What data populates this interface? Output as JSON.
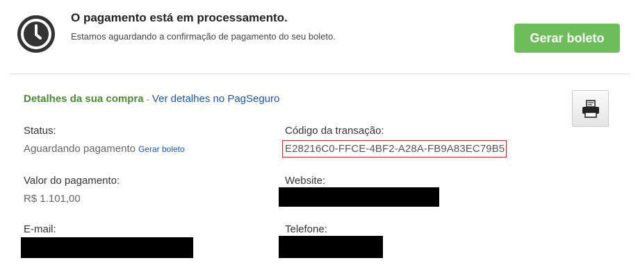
{
  "banner": {
    "title": "O pagamento está em processamento.",
    "description": "Estamos aguardando a confirmação de pagamento do seu boleto.",
    "button_label": "Gerar boleto",
    "icon": "clock-icon",
    "button_color": "#6dbd5b"
  },
  "details": {
    "heading": "Detalhes da sua compra",
    "separator": "-",
    "link": "Ver detalhes no PagSeguro",
    "print_icon": "printer-icon"
  },
  "fields": {
    "status_label": "Status:",
    "status_value": "Aguardando pagamento",
    "status_link": "Gerar boleto",
    "txn_label": "Código da transação:",
    "txn_value": "E28216C0-FFCE-4BF2-A28A-FB9A83EC79B5",
    "amount_label": "Valor do pagamento:",
    "amount_value": "R$ 1.101,00",
    "website_label": "Website:",
    "email_label": "E-mail:",
    "phone_label": "Telefone:"
  },
  "colors": {
    "heading_green": "#4a8c33",
    "link_blue": "#1a55b8",
    "highlight_red": "#d9252a"
  }
}
